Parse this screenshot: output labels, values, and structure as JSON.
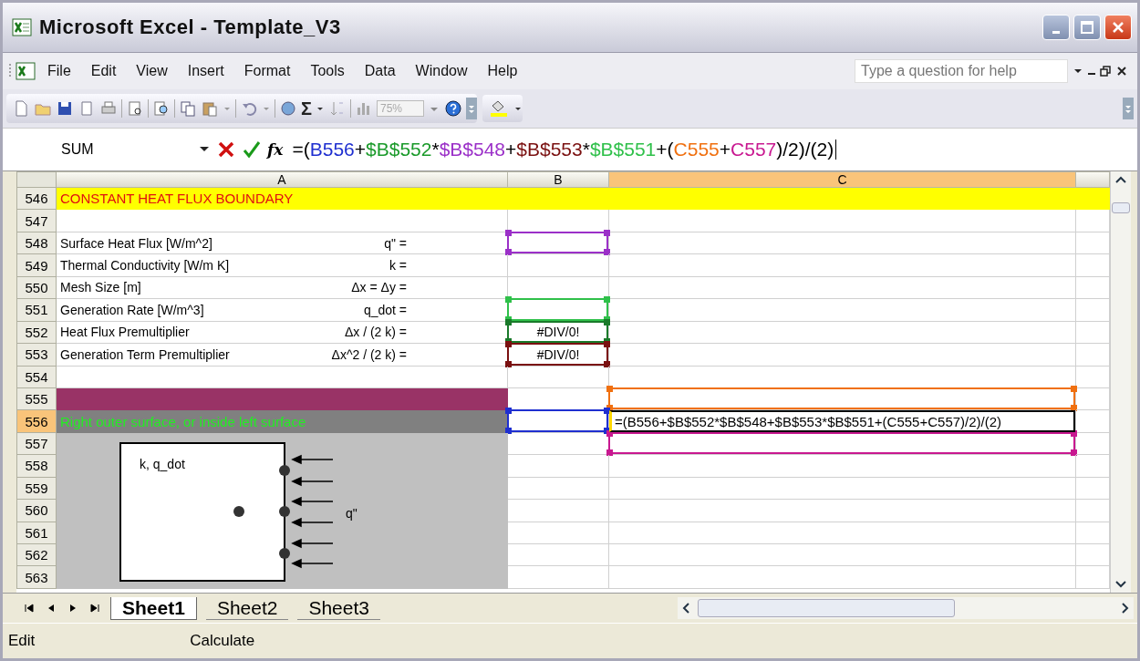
{
  "window": {
    "title": "Microsoft Excel - Template_V3"
  },
  "menu": [
    "File",
    "Edit",
    "View",
    "Insert",
    "Format",
    "Tools",
    "Data",
    "Window",
    "Help"
  ],
  "help_search": {
    "placeholder": "Type a question for help"
  },
  "toolbar": {
    "sum_symbol": "Σ",
    "zoom": "75%"
  },
  "formula_bar": {
    "name_box": "SUM",
    "fx": "fx",
    "formula": [
      {
        "text": "=(",
        "color": "#000000"
      },
      {
        "text": "B556",
        "color": "#1f2fd0"
      },
      {
        "text": "+",
        "color": "#000000"
      },
      {
        "text": "$B$552",
        "color": "#1a9a2a"
      },
      {
        "text": "*",
        "color": "#000000"
      },
      {
        "text": "$B$548",
        "color": "#9b30c8"
      },
      {
        "text": "+",
        "color": "#000000"
      },
      {
        "text": "$B$553",
        "color": "#7a1010"
      },
      {
        "text": "*",
        "color": "#000000"
      },
      {
        "text": "$B$551",
        "color": "#2fc04a"
      },
      {
        "text": "+(",
        "color": "#000000"
      },
      {
        "text": "C555",
        "color": "#f07010"
      },
      {
        "text": "+",
        "color": "#000000"
      },
      {
        "text": "C557",
        "color": "#c81890"
      },
      {
        "text": ")/2)/(2)",
        "color": "#000000"
      }
    ]
  },
  "columns": [
    {
      "label": "A",
      "selected": false
    },
    {
      "label": "B",
      "selected": false
    },
    {
      "label": "C",
      "selected": true
    }
  ],
  "rows": [
    {
      "number": "546",
      "selected": false,
      "kind": "section",
      "a": "CONSTANT HEAT FLUX BOUNDARY"
    },
    {
      "number": "547",
      "selected": false,
      "kind": "plain"
    },
    {
      "number": "548",
      "selected": false,
      "kind": "plain",
      "a": "Surface Heat Flux [W/m^2]",
      "symbol": "q\" =",
      "b_ref": {
        "color": "#9b30c8"
      }
    },
    {
      "number": "549",
      "selected": false,
      "kind": "plain",
      "a": "Thermal Conductivity [W/m K]",
      "symbol": "k ="
    },
    {
      "number": "550",
      "selected": false,
      "kind": "plain",
      "a": "Mesh Size [m]",
      "symbol": "Δx = Δy ="
    },
    {
      "number": "551",
      "selected": false,
      "kind": "plain",
      "a": "Generation Rate [W/m^3]",
      "symbol": "q_dot =",
      "b_ref": {
        "color": "#2fc04a"
      }
    },
    {
      "number": "552",
      "selected": false,
      "kind": "plain",
      "a": "Heat Flux Premultiplier",
      "symbol": "Δx  / (2 k) =",
      "b": "#DIV/0!",
      "b_ref": {
        "color": "#1a7a2a"
      }
    },
    {
      "number": "553",
      "selected": false,
      "kind": "plain",
      "a": "Generation Term Premultiplier",
      "symbol": "Δx^2 / (2 k) =",
      "b": "#DIV/0!",
      "b_ref": {
        "color": "#7a1010"
      }
    },
    {
      "number": "554",
      "selected": false,
      "kind": "plain"
    },
    {
      "number": "555",
      "selected": false,
      "kind": "band",
      "c_ref": {
        "color": "#f07010"
      }
    },
    {
      "number": "556",
      "selected": true,
      "kind": "heading",
      "a": "Right outer surface, or inside left surface",
      "b_ref": {
        "color": "#1f2fd0"
      },
      "c": "=(B556+$B$552*$B$548+$B$553*$B$551+(C555+C557)/2)/(2)"
    },
    {
      "number": "557",
      "selected": false,
      "kind": "figure",
      "c_ref": {
        "color": "#c81890"
      }
    },
    {
      "number": "558",
      "selected": false,
      "kind": "figure"
    },
    {
      "number": "559",
      "selected": false,
      "kind": "figure"
    },
    {
      "number": "560",
      "selected": false,
      "kind": "figure"
    },
    {
      "number": "561",
      "selected": false,
      "kind": "figure"
    },
    {
      "number": "562",
      "selected": false,
      "kind": "figure"
    },
    {
      "number": "563",
      "selected": false,
      "kind": "figure"
    }
  ],
  "diagram": {
    "label": "k, q_dot",
    "flux_label": "q\""
  },
  "sheet_tabs": [
    {
      "label": "Sheet1",
      "selected": true
    },
    {
      "label": "Sheet2",
      "selected": false
    },
    {
      "label": "Sheet3",
      "selected": false
    }
  ],
  "status_bar": {
    "mode": "Edit",
    "message": "Calculate"
  }
}
